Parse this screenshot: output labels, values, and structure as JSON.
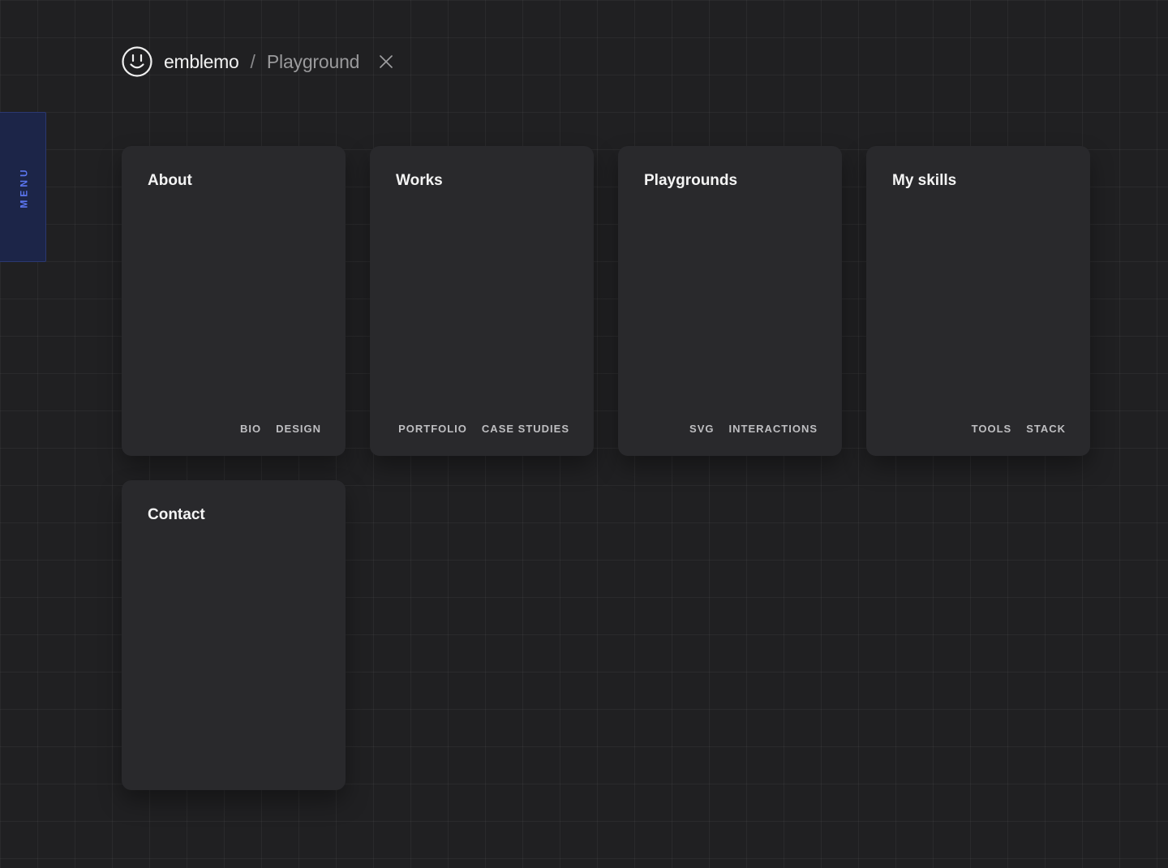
{
  "header": {
    "brand": "emblemo",
    "separator": "/",
    "section": "Playground"
  },
  "menu": {
    "label": "MENU",
    "accent_color": "#5b76f0",
    "background_color": "#1c2548"
  },
  "cards": [
    {
      "title": "About",
      "tags": [
        "BIO",
        "DESIGN"
      ]
    },
    {
      "title": "Works",
      "tags": [
        "PORTFOLIO",
        "CASE STUDIES"
      ]
    },
    {
      "title": "Playgrounds",
      "tags": [
        "SVG",
        "INTERACTIONS"
      ]
    },
    {
      "title": "My skills",
      "tags": [
        "TOOLS",
        "STACK"
      ]
    },
    {
      "title": "Contact",
      "tags": []
    }
  ],
  "icons": {
    "logo": "smiley-face-icon",
    "close": "close-icon"
  }
}
